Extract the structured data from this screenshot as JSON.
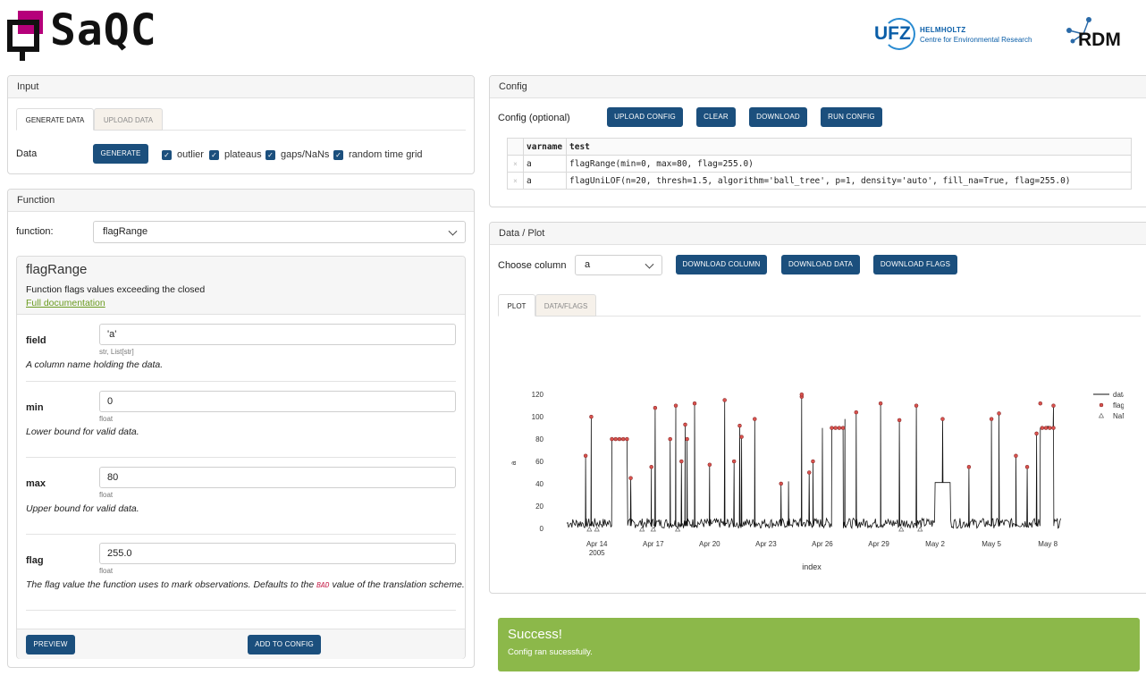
{
  "header": {
    "logo_text": "SaQC",
    "ufz_mark": "UFZ",
    "ufz_name": "HELMHOLTZ",
    "ufz_sub": "Centre for Environmental Research",
    "rdm_text": "RDM"
  },
  "input": {
    "title": "Input",
    "tabs": [
      "GENERATE DATA",
      "UPLOAD DATA"
    ],
    "data_label": "Data",
    "generate_button": "GENERATE",
    "checkboxes": [
      {
        "label": "outlier",
        "checked": true
      },
      {
        "label": "plateaus",
        "checked": true
      },
      {
        "label": "gaps/NaNs",
        "checked": true
      },
      {
        "label": "random time grid",
        "checked": true
      }
    ]
  },
  "function": {
    "title": "Function",
    "label": "function:",
    "selected": "flagRange",
    "name": "flagRange",
    "description": "Function flags values exceeding the closed",
    "doc_link": "Full documentation",
    "params": [
      {
        "name": "field",
        "value": "'a'",
        "type": "str, List[str]",
        "desc": "A column name holding the data."
      },
      {
        "name": "min",
        "value": "0",
        "type": "float",
        "desc": "Lower bound for valid data."
      },
      {
        "name": "max",
        "value": "80",
        "type": "float",
        "desc": "Upper bound for valid data."
      },
      {
        "name": "flag",
        "value": "255.0",
        "type": "float",
        "desc_pre": "The flag value the function uses to mark observations. Defaults to the ",
        "desc_code": "BAD",
        "desc_post": " value of the translation scheme."
      }
    ],
    "preview_button": "PREVIEW",
    "add_button": "ADD TO CONFIG"
  },
  "config": {
    "title": "Config",
    "label": "Config (optional)",
    "buttons": [
      "UPLOAD CONFIG",
      "CLEAR",
      "DOWNLOAD",
      "RUN CONFIG"
    ],
    "columns": [
      "varname",
      "test"
    ],
    "rows": [
      {
        "delete": "×",
        "varname": "a",
        "test": "flagRange(min=0, max=80, flag=255.0)"
      },
      {
        "delete": "×",
        "varname": "a",
        "test": "flagUniLOF(n=20, thresh=1.5, algorithm='ball_tree', p=1, density='auto', fill_na=True, flag=255.0)"
      }
    ]
  },
  "plot_panel": {
    "title": "Data / Plot",
    "choose_label": "Choose column",
    "selected_column": "a",
    "buttons": [
      "DOWNLOAD COLUMN",
      "DOWNLOAD DATA",
      "DOWNLOAD FLAGS"
    ],
    "tabs": [
      "PLOT",
      "DATA/FLAGS"
    ]
  },
  "success": {
    "title": "Success!",
    "message": "Config ran sucessfully."
  },
  "colors": {
    "primary": "#1b4f7d",
    "success": "#8cb84a",
    "flag": "#d9534f",
    "accent": "#b5007a",
    "link": "#6a9a1f"
  },
  "chart_data": {
    "type": "line",
    "xlabel": "index",
    "ylabel": "a",
    "ylim": [
      -5,
      125
    ],
    "yticks": [
      0,
      20,
      40,
      60,
      80,
      100,
      120
    ],
    "xticks": [
      "Apr 14",
      "Apr 17",
      "Apr 20",
      "Apr 23",
      "Apr 26",
      "Apr 29",
      "May 2",
      "May 5",
      "May 8"
    ],
    "xtick_sub": "2005",
    "legend": [
      "data",
      "flags",
      "NaNs"
    ],
    "legend_position": "top-right",
    "x_range_days": [
      12.3,
      38.8
    ],
    "spikes": [
      [
        13.4,
        65
      ],
      [
        13.7,
        100
      ],
      [
        14.8,
        80
      ],
      [
        15.1,
        80
      ],
      [
        15.3,
        80
      ],
      [
        15.5,
        80
      ],
      [
        15.8,
        45
      ],
      [
        16.9,
        55
      ],
      [
        17.1,
        108
      ],
      [
        17.9,
        80
      ],
      [
        18.2,
        110
      ],
      [
        18.5,
        60
      ],
      [
        18.7,
        93
      ],
      [
        18.8,
        80
      ],
      [
        19.2,
        112
      ],
      [
        20.0,
        57
      ],
      [
        20.8,
        115
      ],
      [
        21.3,
        60
      ],
      [
        21.6,
        92
      ],
      [
        21.7,
        82
      ],
      [
        22.4,
        98
      ],
      [
        23.8,
        40
      ],
      [
        24.2,
        42
      ],
      [
        24.9,
        118
      ],
      [
        25.3,
        50
      ],
      [
        25.5,
        60
      ],
      [
        26.0,
        90
      ],
      [
        26.8,
        90
      ],
      [
        27.2,
        98
      ],
      [
        27.8,
        104
      ],
      [
        29.1,
        112
      ],
      [
        30.1,
        97
      ],
      [
        31.0,
        110
      ],
      [
        32.4,
        98
      ],
      [
        33.8,
        55
      ],
      [
        35.0,
        98
      ],
      [
        35.4,
        103
      ],
      [
        36.3,
        65
      ],
      [
        36.9,
        55
      ],
      [
        37.4,
        85
      ],
      [
        37.6,
        90
      ],
      [
        38.0,
        92
      ],
      [
        38.3,
        110
      ]
    ],
    "plateaus": [
      [
        14.8,
        15.6,
        80
      ],
      [
        26.5,
        27.1,
        90
      ],
      [
        32.0,
        32.8,
        41
      ],
      [
        37.6,
        38.3,
        90
      ]
    ],
    "flags": [
      [
        13.4,
        65
      ],
      [
        13.7,
        100
      ],
      [
        14.8,
        80
      ],
      [
        15.0,
        80
      ],
      [
        15.2,
        80
      ],
      [
        15.4,
        80
      ],
      [
        15.6,
        80
      ],
      [
        15.8,
        45
      ],
      [
        16.9,
        55
      ],
      [
        17.1,
        108
      ],
      [
        17.9,
        80
      ],
      [
        18.2,
        110
      ],
      [
        18.5,
        60
      ],
      [
        18.7,
        93
      ],
      [
        18.8,
        80
      ],
      [
        19.2,
        112
      ],
      [
        20.0,
        57
      ],
      [
        20.8,
        115
      ],
      [
        21.3,
        60
      ],
      [
        21.6,
        92
      ],
      [
        21.7,
        82
      ],
      [
        22.4,
        98
      ],
      [
        23.8,
        40
      ],
      [
        24.9,
        118
      ],
      [
        24.9,
        120
      ],
      [
        25.3,
        50
      ],
      [
        25.5,
        60
      ],
      [
        26.5,
        90
      ],
      [
        26.7,
        90
      ],
      [
        26.9,
        90
      ],
      [
        27.1,
        90
      ],
      [
        27.8,
        104
      ],
      [
        29.1,
        112
      ],
      [
        30.1,
        97
      ],
      [
        31.0,
        110
      ],
      [
        32.4,
        98
      ],
      [
        33.8,
        55
      ],
      [
        35.0,
        98
      ],
      [
        35.4,
        103
      ],
      [
        36.3,
        65
      ],
      [
        36.9,
        55
      ],
      [
        37.4,
        85
      ],
      [
        37.7,
        90
      ],
      [
        37.9,
        90
      ],
      [
        38.1,
        90
      ],
      [
        38.3,
        90
      ],
      [
        38.3,
        110
      ],
      [
        37.6,
        112
      ]
    ],
    "nans": [
      13.6,
      14.0,
      16.4,
      17.0,
      18.3,
      30.2,
      31.2
    ]
  }
}
